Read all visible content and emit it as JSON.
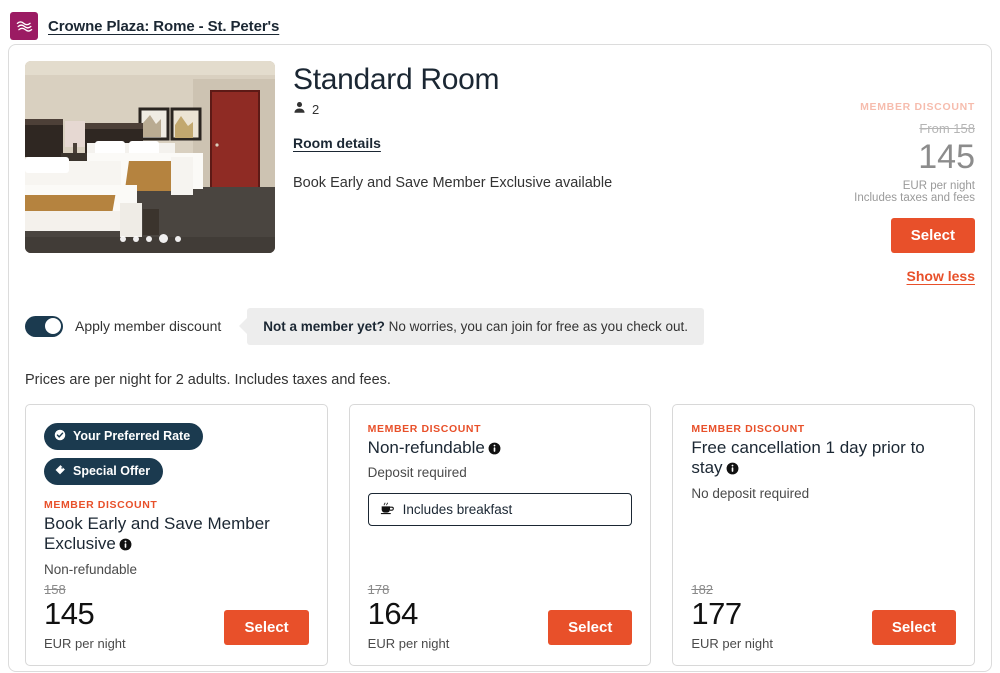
{
  "hotel": {
    "name": "Crowne Plaza: Rome - St. Peter's",
    "logo_icon": "crowne-plaza-waves-icon",
    "logo_color": "#9B1B63"
  },
  "room": {
    "title": "Standard Room",
    "occupancy": "2",
    "occupancy_icon": "person-icon",
    "details_link": "Room details",
    "offer_text": "Book Early and Save Member Exclusive available",
    "photo_alt": "hotel-room-two-beds",
    "carousel": {
      "total_dots": 5,
      "active_index": 3
    }
  },
  "summary_price": {
    "member_discount_label": "MEMBER DISCOUNT",
    "from_price": "From 158",
    "price": "145",
    "currency_note": "EUR per night",
    "taxes_note": "Includes taxes and fees",
    "select_label": "Select",
    "show_less_label": "Show less",
    "accent_color": "#E8502A"
  },
  "member_toggle": {
    "label": "Apply member discount",
    "state": "on",
    "track_color": "#1B3A4F",
    "tooltip_strong": "Not a member yet?",
    "tooltip_text": " No worries, you can join for free as you check out."
  },
  "prices_note": "Prices are per night for 2 adults. Includes taxes and fees.",
  "rate_cards": [
    {
      "badges": [
        {
          "label": "Your Preferred Rate",
          "icon": "check-circle-icon"
        },
        {
          "label": "Special Offer",
          "icon": "tag-icon"
        }
      ],
      "member_discount_label": "MEMBER DISCOUNT",
      "title": "Book Early and Save Member Exclusive",
      "has_info_icon": true,
      "subtitle": "Non-refundable",
      "chip": null,
      "old_price": "158",
      "price": "145",
      "currency_note": "EUR per night",
      "select_label": "Select"
    },
    {
      "badges": [],
      "member_discount_label": "MEMBER DISCOUNT",
      "title": "Non-refundable",
      "has_info_icon": true,
      "subtitle": "Deposit required",
      "chip": {
        "label": "Includes breakfast",
        "icon": "coffee-cup-icon"
      },
      "old_price": "178",
      "price": "164",
      "currency_note": "EUR per night",
      "select_label": "Select"
    },
    {
      "badges": [],
      "member_discount_label": "MEMBER DISCOUNT",
      "title": "Free cancellation 1 day prior to stay",
      "has_info_icon": true,
      "subtitle": "No deposit required",
      "chip": null,
      "old_price": "182",
      "price": "177",
      "currency_note": "EUR per night",
      "select_label": "Select"
    }
  ]
}
